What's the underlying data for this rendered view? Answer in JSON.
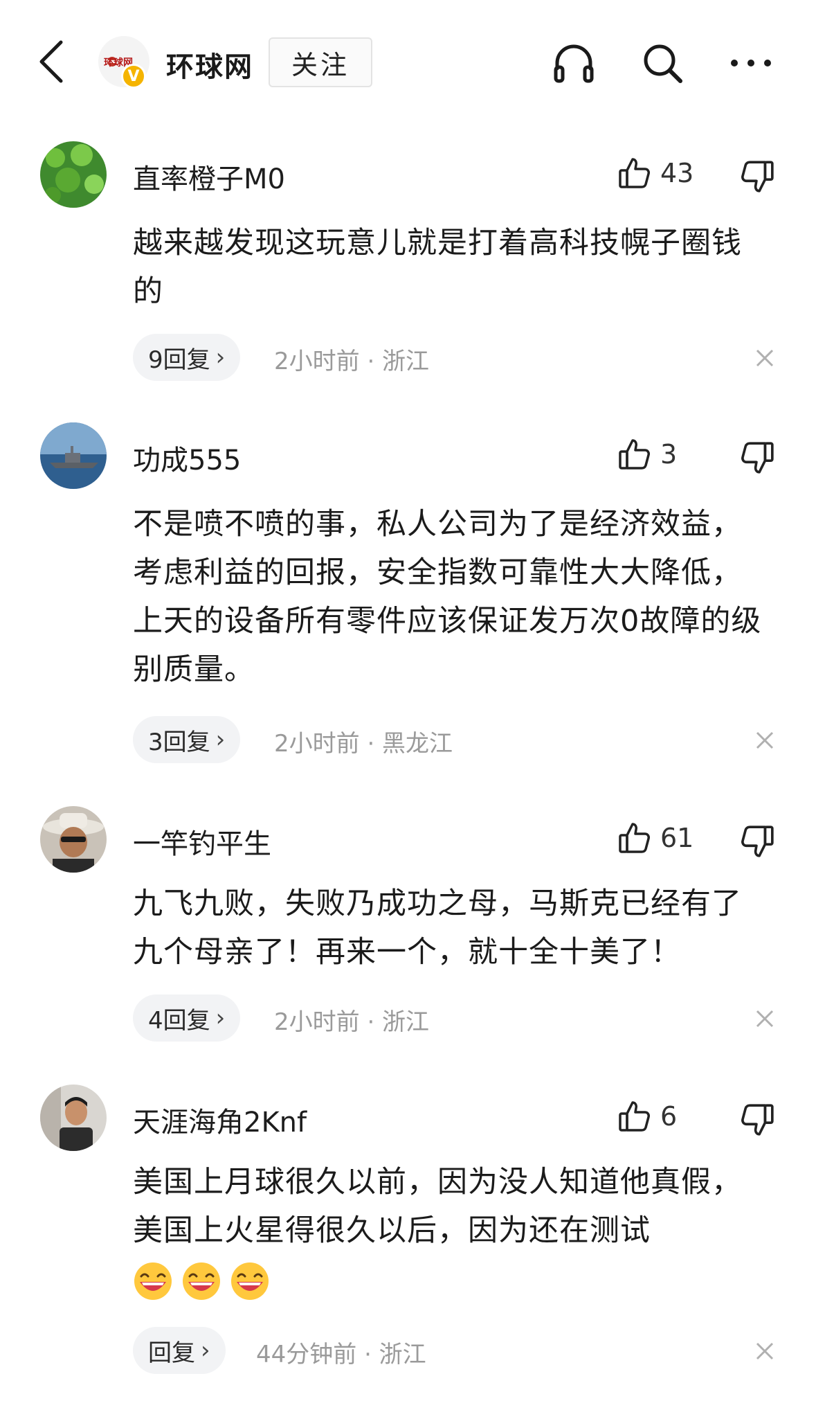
{
  "header": {
    "back_icon": "chevron-left-icon",
    "brand_name": "环球网",
    "brand_mini": "环球网",
    "verified_badge": "V",
    "follow_label": "关注",
    "icons": [
      "headphones-icon",
      "search-icon",
      "more-icon"
    ]
  },
  "comments": [
    {
      "user": "直率橙子M0",
      "likes": "43",
      "text": "越来越发现这玩意儿就是打着高科技幌子圈钱的",
      "replies": "9回复",
      "time": "2小时前 · 浙江"
    },
    {
      "user": "功成555",
      "likes": "3",
      "text": "不是喷不喷的事，私人公司为了是经济效益，考虑利益的回报，安全指数可靠性大大降低，上天的设备所有零件应该保证发万次0故障的级别质量。",
      "replies": "3回复",
      "time": "2小时前 · 黑龙江"
    },
    {
      "user": "一竿钓平生",
      "likes": "61",
      "text": "九飞九败，失败乃成功之母，马斯克已经有了九个母亲了！再来一个，就十全十美了！",
      "replies": "4回复",
      "time": "2小时前 · 浙江"
    },
    {
      "user": "天涯海角2Knf",
      "likes": "6",
      "text": "美国上月球很久以前，因为没人知道他真假，美国上火星得很久以后，因为还在测试",
      "emoji": [
        "grinning-face-emoji",
        "grinning-face-emoji",
        "grinning-face-emoji"
      ],
      "replies": "回复",
      "time": "44分钟前 · 浙江"
    }
  ],
  "colors": {
    "text": "#1b1b1b",
    "meta": "#9a9a9a",
    "pill_bg": "#f2f3f5",
    "badge": "#f5b400"
  }
}
